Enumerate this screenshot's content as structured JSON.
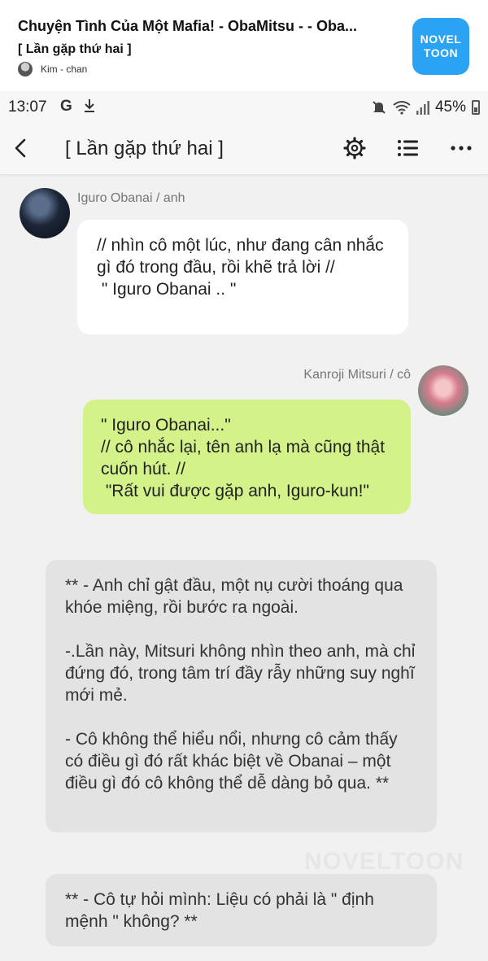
{
  "header": {
    "story_title": "Chuyện Tình Của Một Mafia! - ObaMitsu - - Oba...",
    "chapter_subtitle": "[ Lần gặp thứ hai ]",
    "author": "Kim - chan",
    "logo_line1": "NOVEL",
    "logo_line2": "TOON",
    "logo_color": "#2aa3f5"
  },
  "status_bar": {
    "time": "13:07",
    "g_label": "G",
    "battery": "45%",
    "icons": [
      "download-icon",
      "mute-icon",
      "wifi-icon",
      "signal-icon",
      "battery-icon"
    ]
  },
  "nav": {
    "title": "[ Lần gặp thứ hai ]",
    "icons": [
      "back-icon",
      "gear-icon",
      "list-icon",
      "more-icon"
    ]
  },
  "chat": {
    "obanai": {
      "name": "Iguro Obanai / anh",
      "text": "// nhìn cô một lúc, như đang cân nhắc gì đó trong đầu, rồi khẽ trả lời //\n \" Iguro Obanai .. \""
    },
    "mitsuri": {
      "name": "Kanroji Mitsuri / cô",
      "text": "\" Iguro Obanai...\"\n// cô nhắc lại, tên anh lạ mà cũng thật cuốn hút. //\n \"Rất vui được gặp anh, Iguro-kun!\"",
      "bubble_color": "#d4f28a"
    },
    "narration1": {
      "p1": "** - Anh chỉ gật đầu, một nụ cười thoáng qua khóe miệng, rồi bước ra ngoài.",
      "p2": "-.Lần này, Mitsuri không nhìn theo anh, mà chỉ đứng đó, trong tâm trí đầy rẫy những suy nghĩ mới mẻ.",
      "p3": "- Cô không thể hiểu nổi, nhưng cô cảm thấy có điều gì đó rất khác biệt về Obanai – một điều gì đó cô không thể dễ dàng bỏ qua. **"
    },
    "narration2": {
      "text": "** - Cô tự hỏi mình: Liệu có phải là \" định mệnh \" không? **"
    },
    "watermark": "NOVELTOON"
  }
}
